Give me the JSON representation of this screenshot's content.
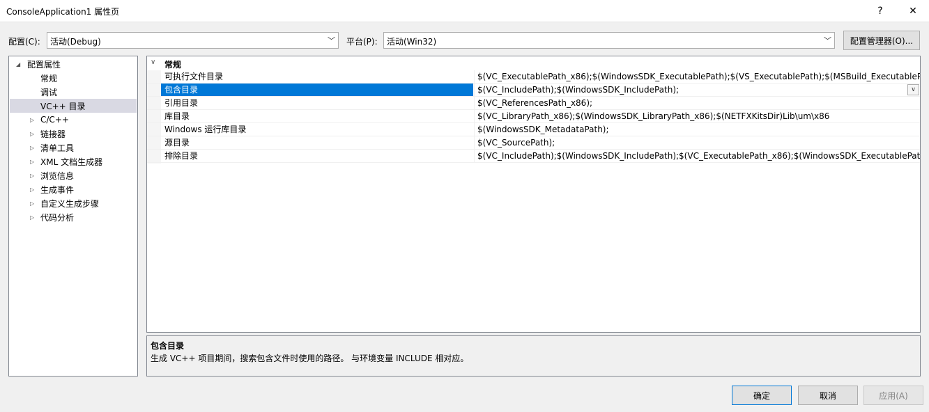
{
  "window": {
    "title": "ConsoleApplication1 属性页",
    "help_glyph": "?",
    "close_glyph": "✕"
  },
  "config_row": {
    "config_label": "配置(C):",
    "config_value": "活动(Debug)",
    "platform_label": "平台(P):",
    "platform_value": "活动(Win32)",
    "manager_button": "配置管理器(O)..."
  },
  "tree": {
    "root": "配置属性",
    "items": [
      {
        "label": "常规",
        "expandable": false
      },
      {
        "label": "调试",
        "expandable": false
      },
      {
        "label": "VC++ 目录",
        "expandable": false,
        "selected": true
      },
      {
        "label": "C/C++",
        "expandable": true
      },
      {
        "label": "链接器",
        "expandable": true
      },
      {
        "label": "清单工具",
        "expandable": true
      },
      {
        "label": "XML 文档生成器",
        "expandable": true
      },
      {
        "label": "浏览信息",
        "expandable": true
      },
      {
        "label": "生成事件",
        "expandable": true
      },
      {
        "label": "自定义生成步骤",
        "expandable": true
      },
      {
        "label": "代码分析",
        "expandable": true
      }
    ]
  },
  "grid": {
    "category": "常规",
    "rows": [
      {
        "name": "可执行文件目录",
        "value": "$(VC_ExecutablePath_x86);$(WindowsSDK_ExecutablePath);$(VS_ExecutablePath);$(MSBuild_ExecutablePath);$(SystemRoot)"
      },
      {
        "name": "包含目录",
        "value": "$(VC_IncludePath);$(WindowsSDK_IncludePath);",
        "selected": true
      },
      {
        "name": "引用目录",
        "value": "$(VC_ReferencesPath_x86);"
      },
      {
        "name": "库目录",
        "value": "$(VC_LibraryPath_x86);$(WindowsSDK_LibraryPath_x86);$(NETFXKitsDir)Lib\\um\\x86"
      },
      {
        "name": "Windows 运行库目录",
        "value": "$(WindowsSDK_MetadataPath);"
      },
      {
        "name": "源目录",
        "value": "$(VC_SourcePath);"
      },
      {
        "name": "排除目录",
        "value": "$(VC_IncludePath);$(WindowsSDK_IncludePath);$(VC_ExecutablePath_x86);$(WindowsSDK_ExecutablePath);$(VS_ExecutablePath)"
      }
    ]
  },
  "description": {
    "title": "包含目录",
    "text": "生成 VC++ 项目期间，搜索包含文件时使用的路径。 与环境变量 INCLUDE 相对应。"
  },
  "footer": {
    "ok": "确定",
    "cancel": "取消",
    "apply": "应用(A)"
  }
}
